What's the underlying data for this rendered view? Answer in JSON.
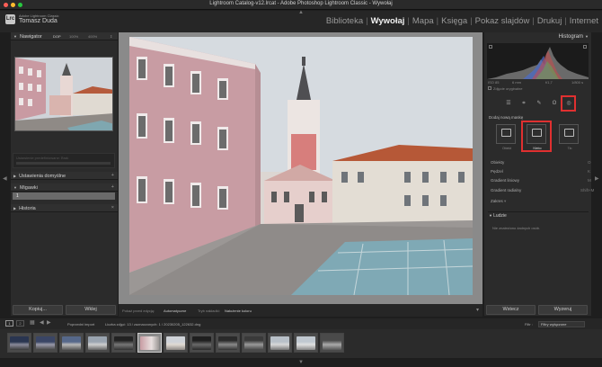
{
  "window": {
    "title": "Lightroom Catalog-v12.lrcat - Adobe Photoshop Lightroom Classic - Wywołaj"
  },
  "identity": {
    "product": "Adobe Lightroom Classic",
    "user": "Tomasz Duda"
  },
  "modules": [
    {
      "label": "Biblioteka"
    },
    {
      "label": "Wywołaj",
      "active": true
    },
    {
      "label": "Mapa"
    },
    {
      "label": "Księga"
    },
    {
      "label": "Pokaz slajdów"
    },
    {
      "label": "Drukuj"
    },
    {
      "label": "Internet"
    }
  ],
  "left": {
    "navigator": {
      "title": "Nawigator",
      "zoom": [
        "DOP",
        "100%",
        "400%"
      ]
    },
    "preset_hint": "Ustawienie predefiniowane: Brak",
    "panels": {
      "presets": "Ustawienia domyślne",
      "snapshots": "Migawki",
      "history": "Historia"
    },
    "snapshot_item": "1",
    "buttons": {
      "copy": "Kopiuj...",
      "paste": "Wklej"
    }
  },
  "toolbar": {
    "show_edit_label": "Pokaż przed edycją:",
    "show_edit_value": "Automatyczne",
    "mode_label": "Tryb nakładki:",
    "mode_value": "Nałożenie koloru"
  },
  "right": {
    "histogram": {
      "title": "Histogram",
      "readouts": [
        "ISO 85",
        "6 mm",
        "f/1,7",
        "1/800 s"
      ],
      "original_photo": "Zdjęcie oryginalne"
    },
    "mask": {
      "add_label": "Dodaj nową maskę",
      "types": [
        {
          "label": "Obiekt"
        },
        {
          "label": "Niebo",
          "selected": true
        },
        {
          "label": "Tło"
        }
      ],
      "tools": [
        {
          "label": "Obiekty",
          "key": "O"
        },
        {
          "label": "Pędzel",
          "key": "K"
        },
        {
          "label": "Gradient liniowy",
          "key": "M"
        },
        {
          "label": "Gradient radialny",
          "key": "Shift+M"
        },
        {
          "label": "Zakres"
        }
      ],
      "people": {
        "title": "Ludzie",
        "empty": "Nie znaleziono żadnych osób."
      }
    },
    "buttons": {
      "previous": "Wstecz",
      "reset": "Wyzeruj"
    }
  },
  "filmstrip": {
    "source": "Poprzedni import",
    "info": "Liczba zdjęć: 13 / zaznaczonych: 1 / 20230205_122632.dng",
    "filter_label": "Filtr :",
    "filter_value": "Filtry wyłączone",
    "pages": [
      "1",
      "2"
    ]
  },
  "colors": {
    "accent": "#e03030",
    "active_module": "#f0f0f0",
    "panel_bg": "#2b2b2b"
  }
}
